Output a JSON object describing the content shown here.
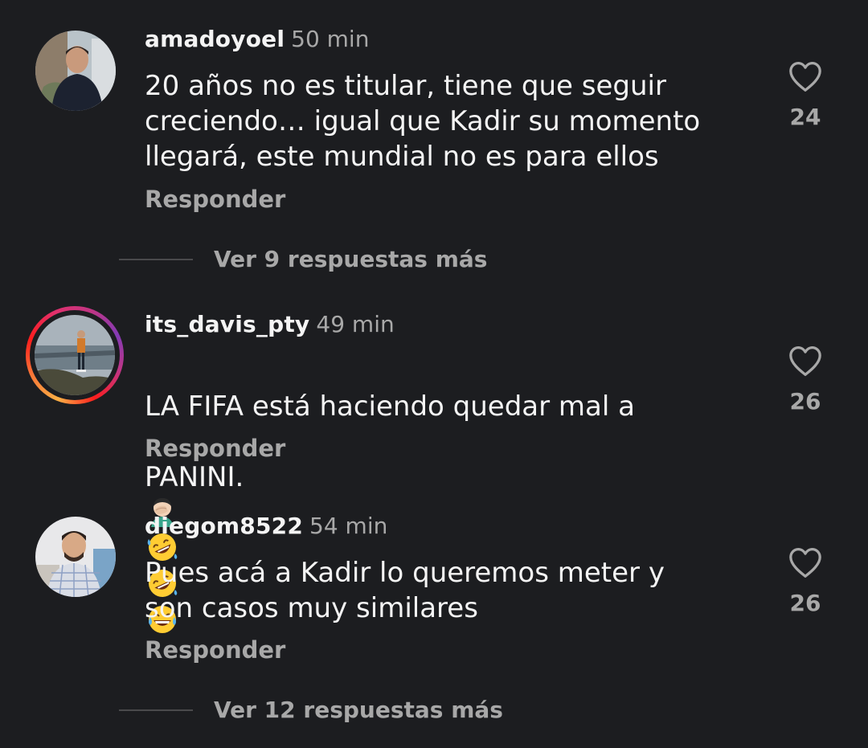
{
  "comments": [
    {
      "username": "amadoyoel",
      "time": "50 min",
      "text": "20 años no es titular, tiene que seguir\ncreciendo… igual que Kadir su momento\nllegará, este mundial no es para ellos",
      "reply_label": "Responder",
      "likes": "24",
      "view_replies": "Ver 9 respuestas más"
    },
    {
      "username": "its_davis_pty",
      "time": "49 min",
      "text_line1": "LA FIFA está haciendo quedar mal a",
      "text_line2": "PANINI.",
      "emojis": [
        "man-facepalming-emoji",
        "rolling-on-floor-laughing-emoji",
        "rolling-on-floor-laughing-emoji",
        "face-with-tears-of-joy-emoji"
      ],
      "reply_label": "Responder",
      "likes": "26",
      "has_story": true
    },
    {
      "username": "diegom8522",
      "time": "54 min",
      "text": "Pues acá a Kadir lo queremos meter y\nson casos muy similares",
      "reply_label": "Responder",
      "likes": "26",
      "view_replies": "Ver 12 respuestas más"
    }
  ],
  "colors": {
    "background": "#1c1d20",
    "primary_text": "#f4f4f4",
    "secondary_text": "#a8a8a8"
  },
  "icons": {
    "like": "heart-outline-icon"
  }
}
